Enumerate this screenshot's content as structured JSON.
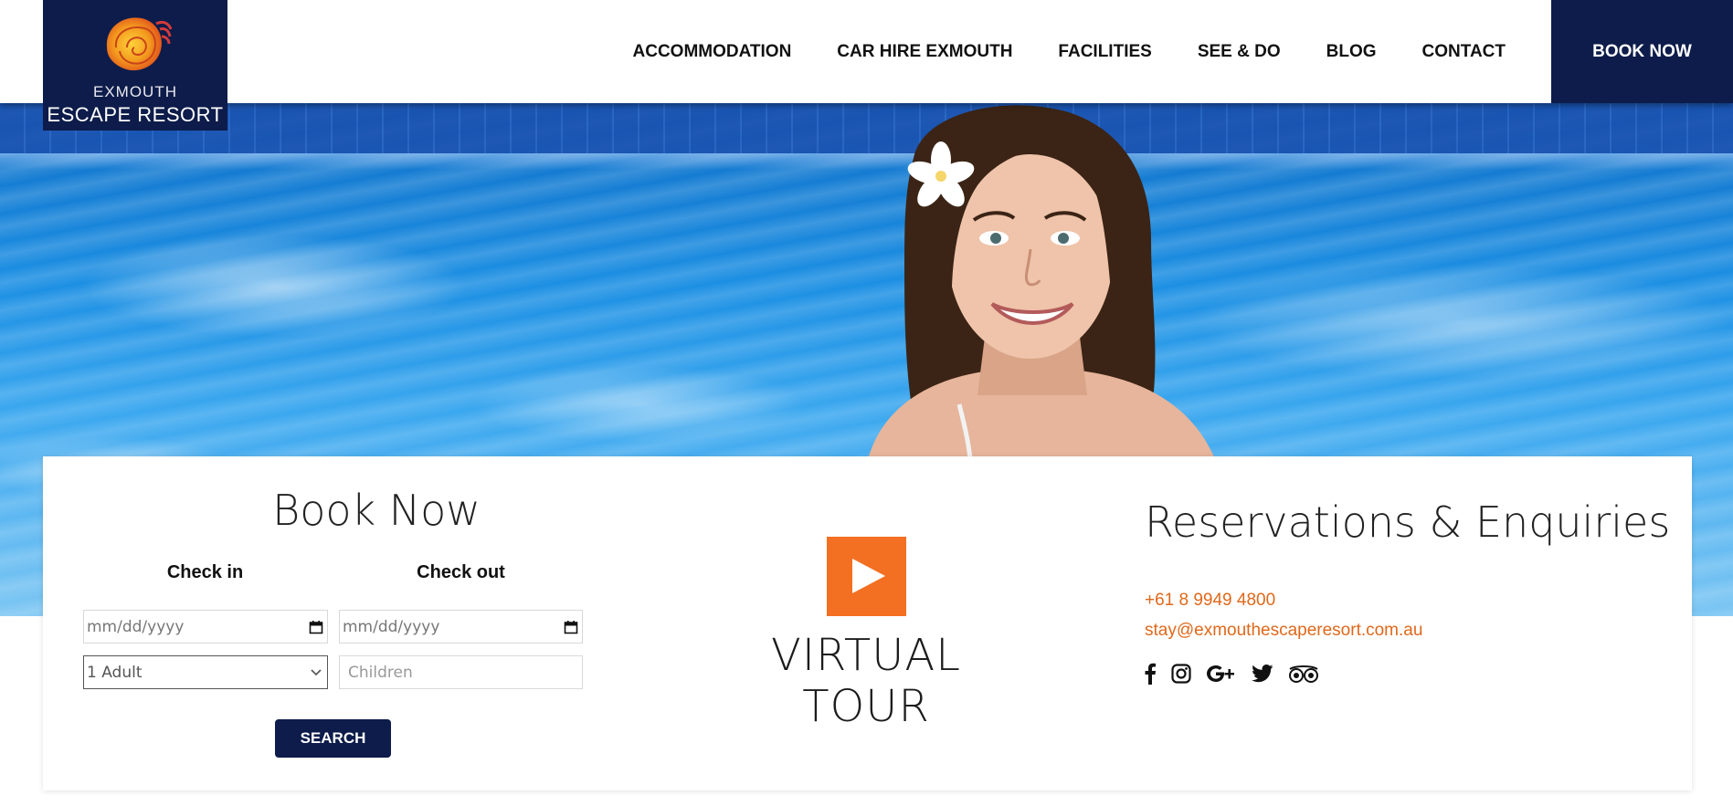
{
  "brand": {
    "top": "EXMOUTH",
    "bottom": "ESCAPE RESORT",
    "bg_color": "#0d1c4a",
    "shell_icon": "nautilus-shell-icon"
  },
  "nav": {
    "items": [
      "ACCOMMODATION",
      "CAR HIRE EXMOUTH",
      "FACILITIES",
      "SEE & DO",
      "BLOG",
      "CONTACT"
    ],
    "book_now": "BOOK NOW"
  },
  "booking": {
    "title": "Book Now",
    "checkin_label": "Check in",
    "checkout_label": "Check out",
    "checkin_placeholder": "mm/dd/yyyy",
    "checkout_placeholder": "mm/dd/yyyy",
    "adults_selected": "1 Adult",
    "children_placeholder": "Children",
    "search_label": "SEARCH"
  },
  "tour": {
    "label": "VIRTUAL TOUR",
    "play_color": "#f36f21",
    "icon": "play-icon"
  },
  "reservations": {
    "title": "Reservations & Enquiries",
    "phone": "+61 8 9949 4800",
    "email": "stay@exmouthescaperesort.com.au",
    "link_color": "#e0681b",
    "socials": [
      "facebook-icon",
      "instagram-icon",
      "google-plus-icon",
      "twitter-icon",
      "tripadvisor-icon"
    ]
  }
}
